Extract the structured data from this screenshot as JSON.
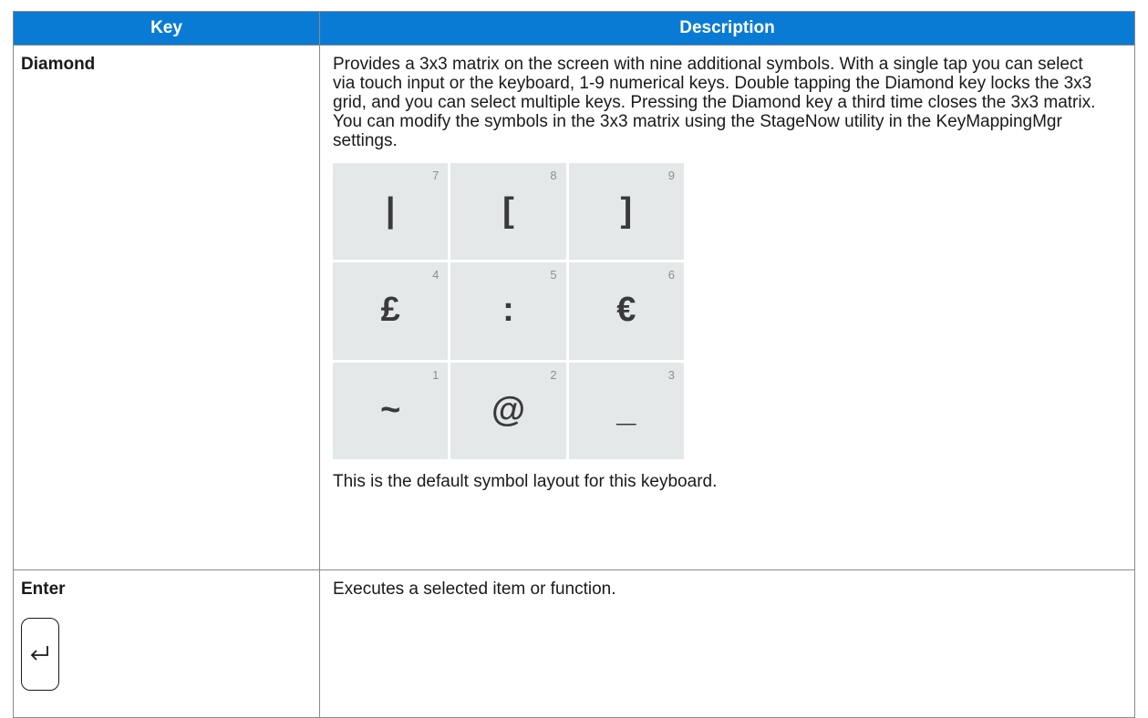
{
  "table": {
    "headers": {
      "key": "Key",
      "description": "Description"
    },
    "rows": [
      {
        "key": "Diamond",
        "description": "Provides a 3x3 matrix on the screen with nine additional symbols. With a single tap you can select via touch input or the keyboard, 1-9 numerical keys. Double tapping the Diamond key locks the 3x3 grid, and you can select multiple keys. Pressing the Diamond key a third time closes the 3x3 matrix. You can modify the symbols in the 3x3 matrix using the StageNow utility in the KeyMappingMgr settings.",
        "symbol_matrix": [
          {
            "number": "7",
            "symbol": "|"
          },
          {
            "number": "8",
            "symbol": "["
          },
          {
            "number": "9",
            "symbol": "]"
          },
          {
            "number": "4",
            "symbol": "£"
          },
          {
            "number": "5",
            "symbol": ":"
          },
          {
            "number": "6",
            "symbol": "€"
          },
          {
            "number": "1",
            "symbol": "~"
          },
          {
            "number": "2",
            "symbol": "@"
          },
          {
            "number": "3",
            "symbol": "_"
          }
        ],
        "caption": "This is the default symbol layout for this keyboard."
      },
      {
        "key": "Enter",
        "icon": "enter-return-icon",
        "description": "Executes a selected item or function."
      }
    ]
  },
  "colors": {
    "header_bg": "#0a7bd4",
    "header_text": "#ffffff",
    "border": "#8a8a8a",
    "key_bg": "#e4e8e8"
  }
}
